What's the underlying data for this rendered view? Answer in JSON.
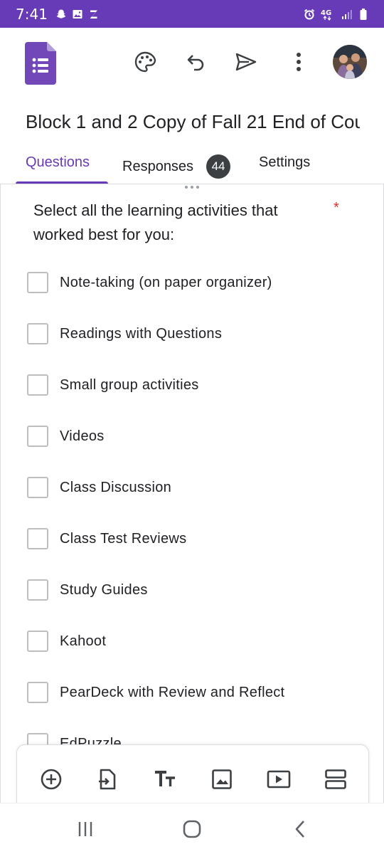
{
  "status_bar": {
    "time": "7:41",
    "left_icons": [
      "snapchat-icon",
      "gallery-icon",
      "z-app-icon"
    ],
    "right_icons": [
      "alarm-icon",
      "4g-icon",
      "signal-icon",
      "battery-icon"
    ],
    "network": "4G"
  },
  "app_bar": {
    "logo": "google-forms-icon",
    "actions": [
      "palette-icon",
      "undo-icon",
      "send-icon",
      "more-vert-icon",
      "avatar"
    ]
  },
  "form": {
    "title": "Block 1 and 2 Copy of Fall 21 End of Cou"
  },
  "tabs": [
    {
      "label": "Questions",
      "active": true
    },
    {
      "label": "Responses",
      "badge": "44"
    },
    {
      "label": "Settings"
    }
  ],
  "question": {
    "text": "Select all the learning activities that worked best for you:",
    "required_mark": "*",
    "options": [
      "Note-taking (on paper organizer)",
      "Readings with Questions",
      "Small group activities",
      "Videos",
      "Class Discussion",
      "Class Test Reviews",
      "Study Guides",
      "Kahoot",
      "PearDeck with Review and Reflect",
      "EdPuzzle"
    ]
  },
  "bottom_toolbar": [
    "add-question-icon",
    "import-questions-icon",
    "add-title-icon",
    "add-image-icon",
    "add-video-icon",
    "add-section-icon"
  ],
  "nav_bar": [
    "recent-apps-icon",
    "home-icon",
    "back-icon"
  ],
  "colors": {
    "accent": "#673ab7",
    "status_bar": "#673ab7",
    "required": "#d93025",
    "badge_bg": "#3c4043"
  }
}
